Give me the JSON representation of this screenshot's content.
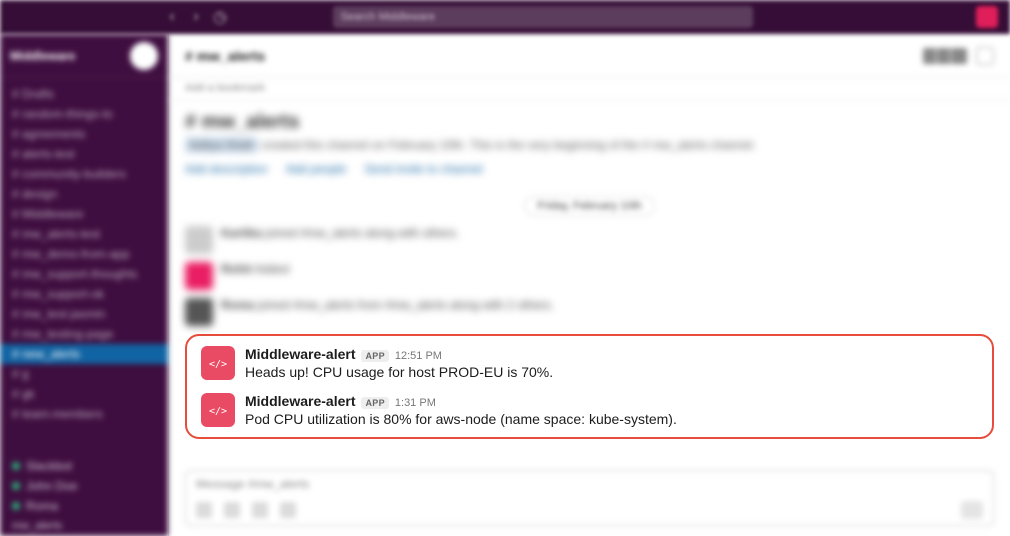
{
  "top": {
    "search_placeholder": "Search Middleware"
  },
  "workspace": {
    "name": "Middleware"
  },
  "sidebar": {
    "items": [
      "Drafts",
      "random-things-to",
      "agreements",
      "alerts-test",
      "community-builders",
      "design",
      "Middleware",
      "mw_alerts-test",
      "mw_demo-from-app",
      "mw_support-thoughts",
      "mw_support-ok",
      "mw_test-jasmin",
      "mw_testing-page",
      "new_alerts",
      "g",
      "gk",
      "team-members"
    ],
    "active_index": 13,
    "dms": [
      "Slackbot",
      "John Doe",
      "Roma"
    ],
    "bottom": "mw_alerts"
  },
  "channel": {
    "name": "# mw_alerts",
    "topic": "Add a bookmark"
  },
  "intro": {
    "heading": "# mw_alerts",
    "badge": "Aditya Shah",
    "text": "created this channel on February 10th. This is the very beginning of the # mw_alerts channel.",
    "links": [
      "Add description",
      "Add people",
      "Send invite to channel"
    ]
  },
  "date_divider": "Friday, February 10th",
  "blurred_messages": [
    {
      "name": "Kartika",
      "text": "joined #mw_alerts along with others.",
      "avatar": "grey"
    },
    {
      "name": "Rohit",
      "text": "Added",
      "avatar": "pink"
    },
    {
      "name": "Roma",
      "text": "joined #mw_alerts from #mw_alerts along with 2 others.",
      "avatar": "dark"
    }
  ],
  "alerts": [
    {
      "sender": "Middleware-alert",
      "badge": "APP",
      "time": "12:51 PM",
      "text": "Heads up! CPU usage for host PROD-EU is 70%."
    },
    {
      "sender": "Middleware-alert",
      "badge": "APP",
      "time": "1:31 PM",
      "text": "Pod CPU utilization is 80% for aws-node (name space: kube-system)."
    }
  ],
  "composer": {
    "placeholder": "Message #mw_alerts"
  }
}
